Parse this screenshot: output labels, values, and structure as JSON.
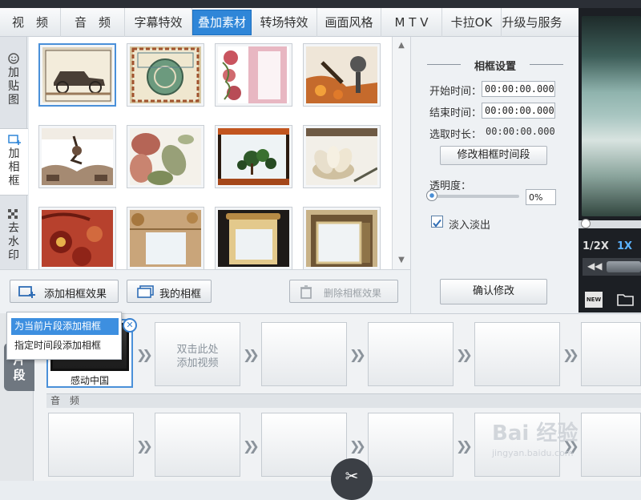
{
  "tabs": [
    "视　频",
    "音　频",
    "字幕特效",
    "叠加素材",
    "转场特效",
    "画面风格",
    "M T V",
    "卡拉OK",
    "升级与服务"
  ],
  "active_tab": "叠加素材",
  "vtabs": [
    {
      "label": "加\n贴\n图"
    },
    {
      "label": "加\n相\n框"
    },
    {
      "label": "去\n水\n印"
    }
  ],
  "settings": {
    "title": "相框设置",
    "start_label": "开始时间：",
    "start_value": "00:00:00.000",
    "end_label": "结束时间：",
    "end_value": "00:00:00.000",
    "duration_label": "选取时长：",
    "duration_value": "00:00:00.000",
    "modify_button": "修改相框时间段",
    "opacity_label": "透明度：",
    "opacity_value": "0%",
    "fade_label": "淡入淡出",
    "confirm_button": "确认修改"
  },
  "buttons": {
    "add_frame": "添加相框效果",
    "my_frames": "我的相框",
    "delete_frame": "删除相框效果"
  },
  "popup": {
    "item1": "为当前片段添加相框",
    "item2": "指定时间段添加相框"
  },
  "preview": {
    "speed_half": "1/2X",
    "speed_one": "1X"
  },
  "timeline": {
    "side_tab": "片\n段",
    "clip_label": "感动中国",
    "empty_cell_text": "双击此处\n添加视频",
    "audio_header": "音　频"
  },
  "watermark": {
    "brand": "Bai 经验",
    "url": "jingyan.baidu.com"
  },
  "colors": {
    "accent": "#2f86d8",
    "popup_highlight": "#3d8fe0"
  }
}
